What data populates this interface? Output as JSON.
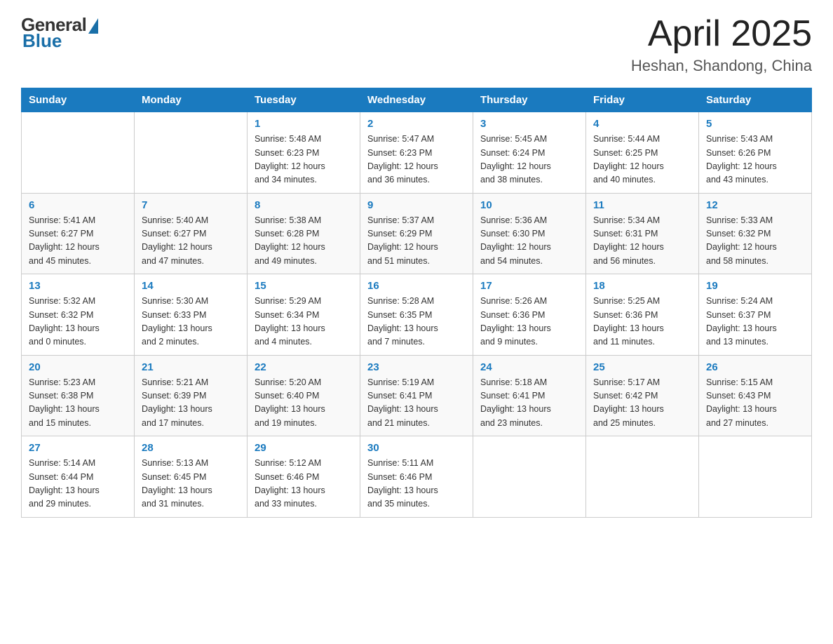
{
  "logo": {
    "general": "General",
    "blue": "Blue"
  },
  "title": "April 2025",
  "location": "Heshan, Shandong, China",
  "headers": [
    "Sunday",
    "Monday",
    "Tuesday",
    "Wednesday",
    "Thursday",
    "Friday",
    "Saturday"
  ],
  "weeks": [
    [
      {
        "day": "",
        "info": ""
      },
      {
        "day": "",
        "info": ""
      },
      {
        "day": "1",
        "info": "Sunrise: 5:48 AM\nSunset: 6:23 PM\nDaylight: 12 hours\nand 34 minutes."
      },
      {
        "day": "2",
        "info": "Sunrise: 5:47 AM\nSunset: 6:23 PM\nDaylight: 12 hours\nand 36 minutes."
      },
      {
        "day": "3",
        "info": "Sunrise: 5:45 AM\nSunset: 6:24 PM\nDaylight: 12 hours\nand 38 minutes."
      },
      {
        "day": "4",
        "info": "Sunrise: 5:44 AM\nSunset: 6:25 PM\nDaylight: 12 hours\nand 40 minutes."
      },
      {
        "day": "5",
        "info": "Sunrise: 5:43 AM\nSunset: 6:26 PM\nDaylight: 12 hours\nand 43 minutes."
      }
    ],
    [
      {
        "day": "6",
        "info": "Sunrise: 5:41 AM\nSunset: 6:27 PM\nDaylight: 12 hours\nand 45 minutes."
      },
      {
        "day": "7",
        "info": "Sunrise: 5:40 AM\nSunset: 6:27 PM\nDaylight: 12 hours\nand 47 minutes."
      },
      {
        "day": "8",
        "info": "Sunrise: 5:38 AM\nSunset: 6:28 PM\nDaylight: 12 hours\nand 49 minutes."
      },
      {
        "day": "9",
        "info": "Sunrise: 5:37 AM\nSunset: 6:29 PM\nDaylight: 12 hours\nand 51 minutes."
      },
      {
        "day": "10",
        "info": "Sunrise: 5:36 AM\nSunset: 6:30 PM\nDaylight: 12 hours\nand 54 minutes."
      },
      {
        "day": "11",
        "info": "Sunrise: 5:34 AM\nSunset: 6:31 PM\nDaylight: 12 hours\nand 56 minutes."
      },
      {
        "day": "12",
        "info": "Sunrise: 5:33 AM\nSunset: 6:32 PM\nDaylight: 12 hours\nand 58 minutes."
      }
    ],
    [
      {
        "day": "13",
        "info": "Sunrise: 5:32 AM\nSunset: 6:32 PM\nDaylight: 13 hours\nand 0 minutes."
      },
      {
        "day": "14",
        "info": "Sunrise: 5:30 AM\nSunset: 6:33 PM\nDaylight: 13 hours\nand 2 minutes."
      },
      {
        "day": "15",
        "info": "Sunrise: 5:29 AM\nSunset: 6:34 PM\nDaylight: 13 hours\nand 4 minutes."
      },
      {
        "day": "16",
        "info": "Sunrise: 5:28 AM\nSunset: 6:35 PM\nDaylight: 13 hours\nand 7 minutes."
      },
      {
        "day": "17",
        "info": "Sunrise: 5:26 AM\nSunset: 6:36 PM\nDaylight: 13 hours\nand 9 minutes."
      },
      {
        "day": "18",
        "info": "Sunrise: 5:25 AM\nSunset: 6:36 PM\nDaylight: 13 hours\nand 11 minutes."
      },
      {
        "day": "19",
        "info": "Sunrise: 5:24 AM\nSunset: 6:37 PM\nDaylight: 13 hours\nand 13 minutes."
      }
    ],
    [
      {
        "day": "20",
        "info": "Sunrise: 5:23 AM\nSunset: 6:38 PM\nDaylight: 13 hours\nand 15 minutes."
      },
      {
        "day": "21",
        "info": "Sunrise: 5:21 AM\nSunset: 6:39 PM\nDaylight: 13 hours\nand 17 minutes."
      },
      {
        "day": "22",
        "info": "Sunrise: 5:20 AM\nSunset: 6:40 PM\nDaylight: 13 hours\nand 19 minutes."
      },
      {
        "day": "23",
        "info": "Sunrise: 5:19 AM\nSunset: 6:41 PM\nDaylight: 13 hours\nand 21 minutes."
      },
      {
        "day": "24",
        "info": "Sunrise: 5:18 AM\nSunset: 6:41 PM\nDaylight: 13 hours\nand 23 minutes."
      },
      {
        "day": "25",
        "info": "Sunrise: 5:17 AM\nSunset: 6:42 PM\nDaylight: 13 hours\nand 25 minutes."
      },
      {
        "day": "26",
        "info": "Sunrise: 5:15 AM\nSunset: 6:43 PM\nDaylight: 13 hours\nand 27 minutes."
      }
    ],
    [
      {
        "day": "27",
        "info": "Sunrise: 5:14 AM\nSunset: 6:44 PM\nDaylight: 13 hours\nand 29 minutes."
      },
      {
        "day": "28",
        "info": "Sunrise: 5:13 AM\nSunset: 6:45 PM\nDaylight: 13 hours\nand 31 minutes."
      },
      {
        "day": "29",
        "info": "Sunrise: 5:12 AM\nSunset: 6:46 PM\nDaylight: 13 hours\nand 33 minutes."
      },
      {
        "day": "30",
        "info": "Sunrise: 5:11 AM\nSunset: 6:46 PM\nDaylight: 13 hours\nand 35 minutes."
      },
      {
        "day": "",
        "info": ""
      },
      {
        "day": "",
        "info": ""
      },
      {
        "day": "",
        "info": ""
      }
    ]
  ]
}
